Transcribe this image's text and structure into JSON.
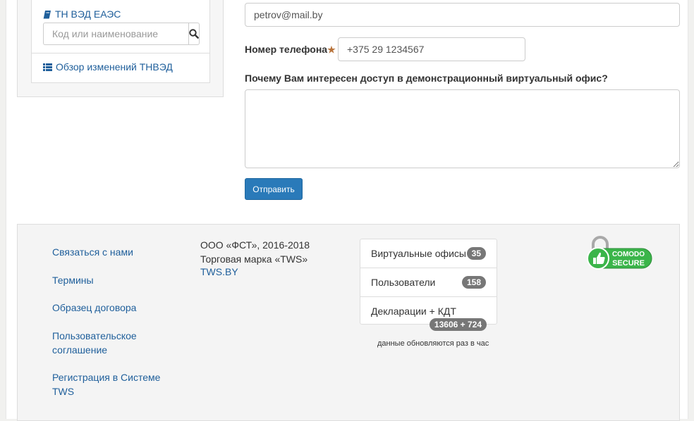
{
  "sidebar": {
    "tnved_link": "ТН ВЭД ЕАЭС",
    "search_placeholder": "Код или наименование",
    "review_link": "Обзор изменений ТНВЭД"
  },
  "form": {
    "email_value": "petrov@mail.by",
    "phone_label": "Номер телефона",
    "phone_required_mark": "★",
    "phone_value": "+375 29 1234567",
    "question_label": "Почему Вам интересен доступ в демонстрационный виртуальный офис?",
    "answer_value": "",
    "submit_label": "Отправить"
  },
  "footer": {
    "links": [
      "Связаться с нами",
      "Термины",
      "Образец договора",
      "Пользовательское соглашение",
      "Регистрация в Системе TWS"
    ],
    "company": "ООО «ФСТ», 2016-2018",
    "trademark": "Торговая марка «TWS»",
    "site_link": "TWS.BY",
    "stats": [
      {
        "label": "Виртуальные офисы",
        "count": "35"
      },
      {
        "label": "Пользователи",
        "count": "158"
      },
      {
        "label": "Декларации + КДТ",
        "count": "13606 + 724"
      }
    ],
    "update_note": "данные обновляются раз в час",
    "comodo_top": "COMODO",
    "comodo_bottom": "SECURE"
  },
  "colors": {
    "link": "#1f5f9b",
    "button": "#2a7ab9",
    "badge": "#777777",
    "comodo_green": "#3bb54a"
  }
}
